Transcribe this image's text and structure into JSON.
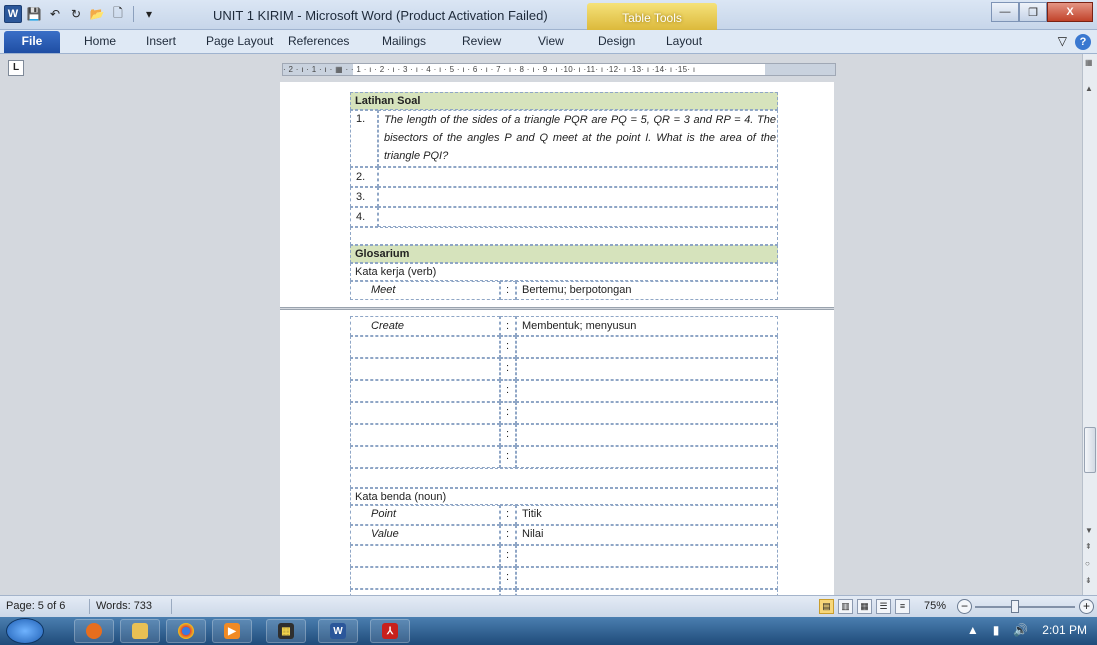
{
  "window": {
    "title": "UNIT 1 KIRIM  -  Microsoft Word (Product Activation Failed)",
    "contextual_tab_group": "Table Tools",
    "minimize": "—",
    "maximize": "❐",
    "close": "X"
  },
  "qat": {
    "app_icon": "W",
    "save": "💾",
    "undo": "↶",
    "redo": "↻",
    "open": "📂",
    "new": "🗋",
    "customize": "▾"
  },
  "ribbon": {
    "tabs": [
      "File",
      "Home",
      "Insert",
      "Page Layout",
      "References",
      "Mailings",
      "Review",
      "View",
      "Design",
      "Layout"
    ],
    "minimize_ribbon": "▽",
    "help": "?"
  },
  "ruler": {
    "corner": "L",
    "labels": "· 2 · ı · 1 · ı · ▦ ·  ·  1 · ı · 2 · ı · 3 · ı · 4 · ı · 5 · ı · 6 · ı · 7 · ı · 8 · ı · 9 · ı ·10· ı ·11· ı ·12· ı ·13· ı  ·14· ı ·15· ı"
  },
  "document": {
    "latihan": {
      "header": "Latihan Soal",
      "items": [
        {
          "num": "1.",
          "text": "The length of the sides of a triangle PQR are PQ = 5, QR = 3 and RP = 4. The bisectors of the angles P and Q meet at the point I. What is the area of the triangle PQI?"
        },
        {
          "num": "2.",
          "text": ""
        },
        {
          "num": "3.",
          "text": ""
        },
        {
          "num": "4.",
          "text": ""
        }
      ]
    },
    "glosarium": {
      "header": "Glosarium",
      "verb_label": "Kata kerja (verb)",
      "verbs": [
        {
          "term": "Meet",
          "sep": ":",
          "meaning": "Bertemu; berpotongan"
        },
        {
          "term": "Create",
          "sep": ":",
          "meaning": "Membentuk; menyusun"
        },
        {
          "term": "",
          "sep": ":",
          "meaning": ""
        },
        {
          "term": "",
          "sep": ":",
          "meaning": ""
        },
        {
          "term": "",
          "sep": ":",
          "meaning": ""
        },
        {
          "term": "",
          "sep": ":",
          "meaning": ""
        },
        {
          "term": "",
          "sep": ":",
          "meaning": ""
        },
        {
          "term": "",
          "sep": ":",
          "meaning": ""
        }
      ],
      "noun_label": "Kata benda (noun)",
      "nouns": [
        {
          "term": "Point",
          "sep": ":",
          "meaning": "Titik"
        },
        {
          "term": "Value",
          "sep": ":",
          "meaning": "Nilai"
        },
        {
          "term": "",
          "sep": ":",
          "meaning": ""
        },
        {
          "term": "",
          "sep": ":",
          "meaning": ""
        },
        {
          "term": "",
          "sep": ":",
          "meaning": ""
        }
      ]
    }
  },
  "status": {
    "page": "Page: 5 of 6",
    "words": "Words: 733",
    "zoom": "75%",
    "zoom_level_percent": 75
  },
  "taskbar": {
    "apps": [
      "Firefox",
      "Windows Explorer",
      "Chrome",
      "Media Player",
      "Calculator",
      "Microsoft Word",
      "Adobe Reader"
    ],
    "time": "2:01 PM"
  },
  "colors": {
    "shade": "#d6e3bc",
    "ribbon_file": "#2a5cb1",
    "table_tools": "#e8c84a"
  }
}
